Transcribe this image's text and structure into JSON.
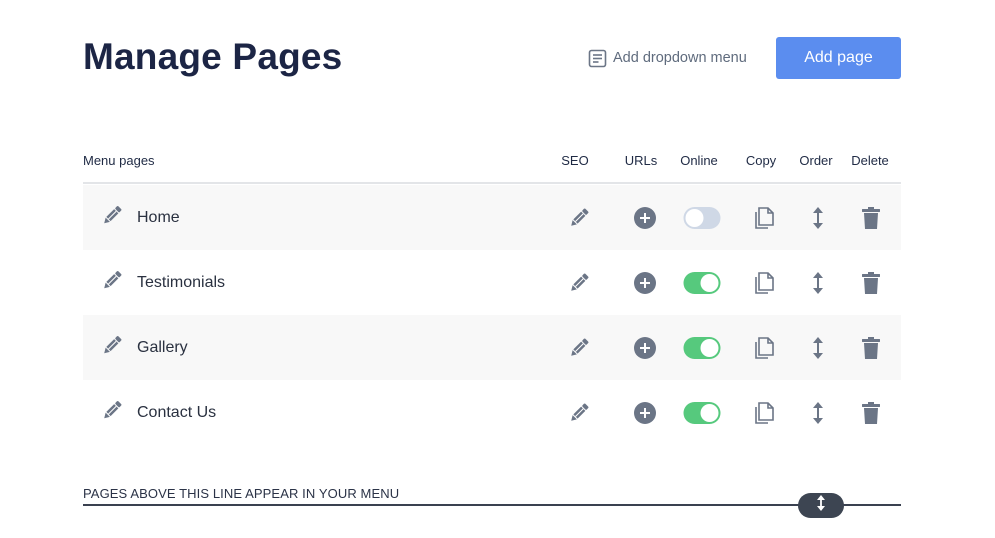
{
  "header": {
    "title": "Manage Pages",
    "dropdown_link_label": "Add dropdown menu",
    "add_page_label": "Add page"
  },
  "table": {
    "columns": {
      "menu_pages": "Menu pages",
      "seo": "SEO",
      "urls": "URLs",
      "online": "Online",
      "copy": "Copy",
      "order": "Order",
      "delete": "Delete"
    },
    "rows": [
      {
        "name": "Home",
        "online": false
      },
      {
        "name": "Testimonials",
        "online": true
      },
      {
        "name": "Gallery",
        "online": true
      },
      {
        "name": "Contact Us",
        "online": true
      }
    ]
  },
  "divider": {
    "label": "PAGES ABOVE THIS LINE APPEAR IN YOUR MENU"
  },
  "colors": {
    "accent": "#5b8def",
    "toggle_on": "#56c97d",
    "toggle_off": "#cfd8e6",
    "icon": "#6b7586",
    "title": "#1c2545"
  },
  "icons": {
    "edit": "pencil-icon",
    "seo": "pencil-icon",
    "urls": "plus-circle-icon",
    "copy": "copy-icon",
    "order": "vertical-arrows-icon",
    "delete": "trash-icon",
    "dropdown": "document-lines-icon"
  }
}
